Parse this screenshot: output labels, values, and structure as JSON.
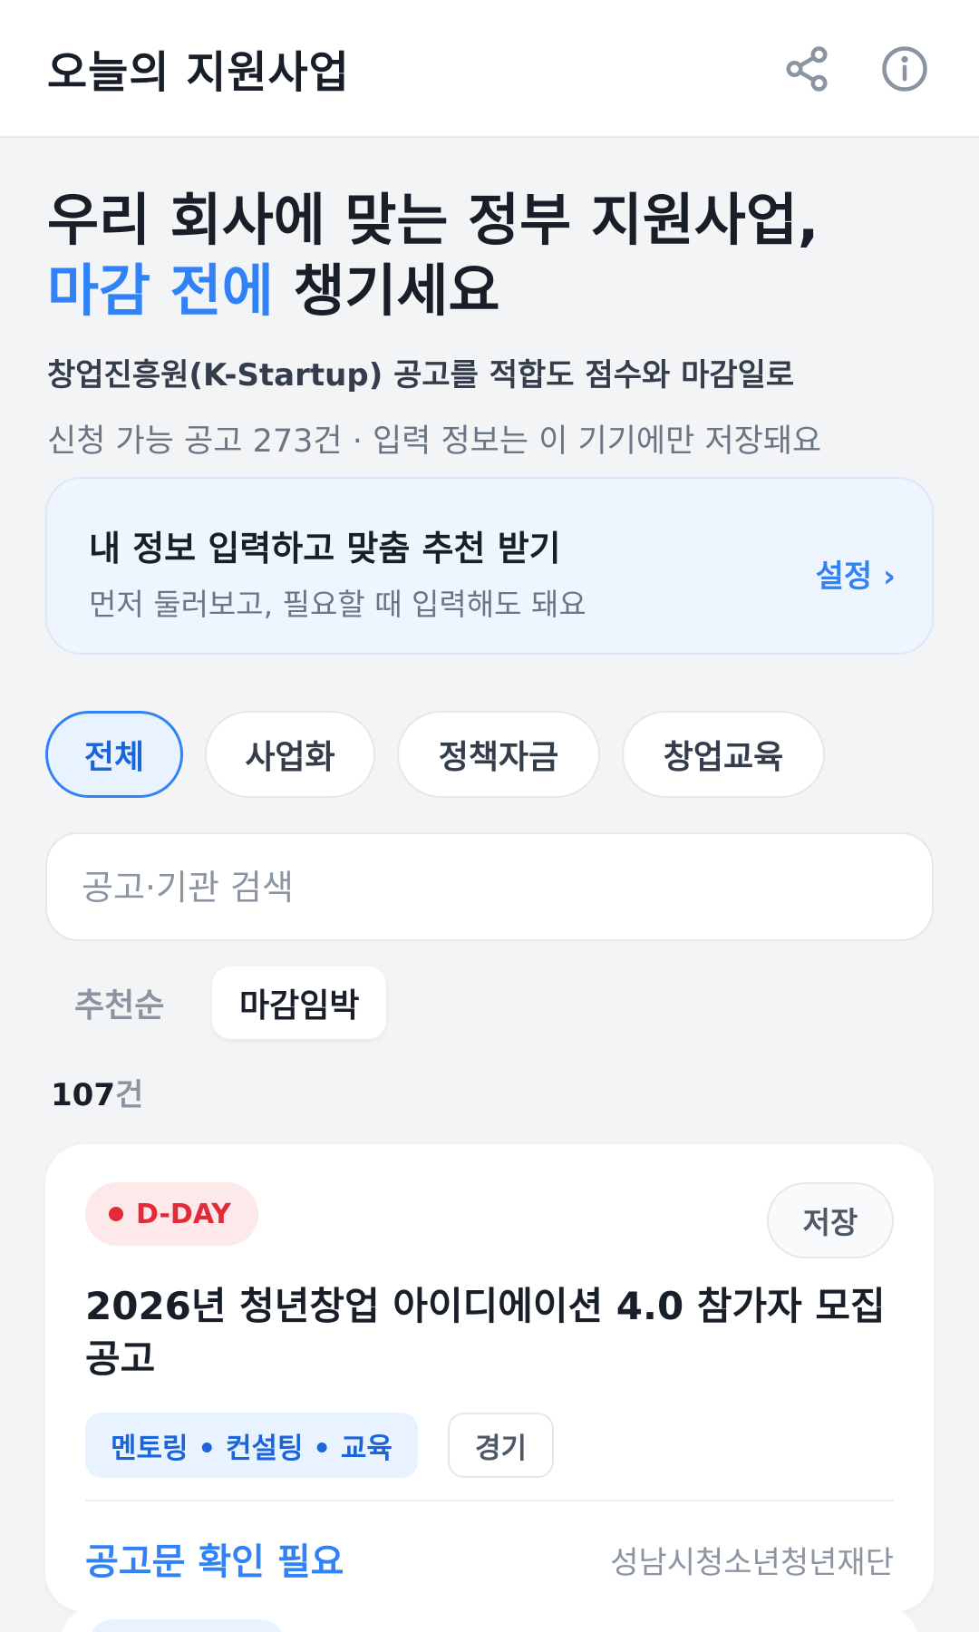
{
  "header": {
    "title": "오늘의 지원사업",
    "share_icon": "share-icon",
    "info_icon": "info-icon"
  },
  "hero": {
    "line1": "우리 회사에 맞는 정부 지원사업,",
    "line2_accent": "마감 전에",
    "line2_rest": " 챙기세요",
    "subtitle": "창업진흥원(K-Startup) 공고를 적합도 점수와 마감일로",
    "meta": "신청 가능 공고 273건 · 입력 정보는 이 기기에만 저장돼요"
  },
  "personalize": {
    "title": "내 정보 입력하고 맞춤 추천 받기",
    "subtitle": "먼저 둘러보고, 필요할 때 입력해도 돼요",
    "link": "설정 ›"
  },
  "filters": [
    {
      "label": "전체",
      "active": true
    },
    {
      "label": "사업화",
      "active": false
    },
    {
      "label": "정책자금",
      "active": false
    },
    {
      "label": "창업교육",
      "active": false
    }
  ],
  "search": {
    "value": "",
    "placeholder": "공고·기관 검색"
  },
  "sort": {
    "tabs": [
      {
        "label": "추천순",
        "active": false
      },
      {
        "label": "마감임박",
        "active": true
      }
    ]
  },
  "results": {
    "count": "107",
    "unit": "건"
  },
  "cards": [
    {
      "badge": "D-DAY",
      "save_label": "저장",
      "title": "2026년 청년창업 아이디에이션 4.0 참가자 모집 공고",
      "tags": [
        "멘토링 • 컨설팅 • 교육",
        "경기"
      ],
      "status": "공고문 확인 필요",
      "agency": "성남시청소년청년재단"
    }
  ],
  "colors": {
    "accent": "#3182f6",
    "danger": "#e42939",
    "background": "#f2f4f6"
  }
}
